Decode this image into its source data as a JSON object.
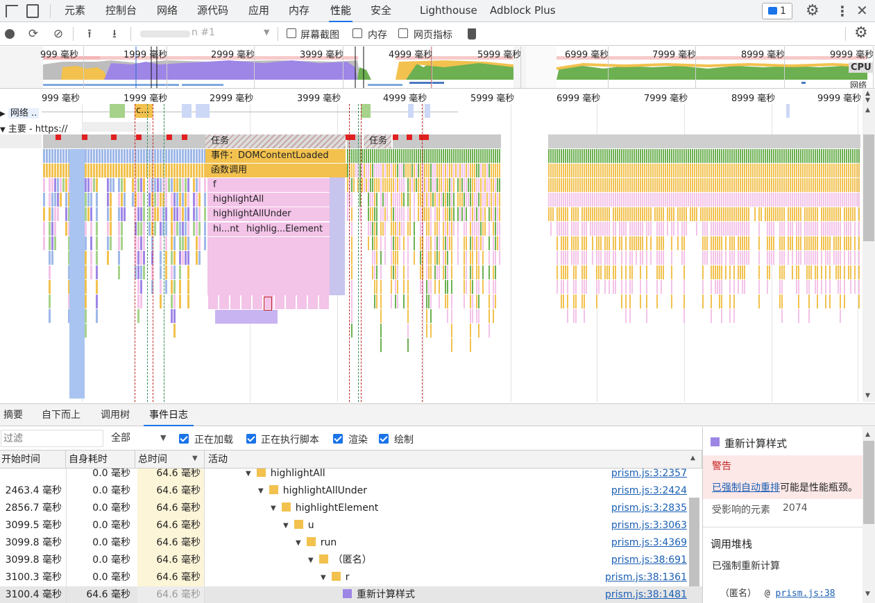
{
  "tabs": [
    "元素",
    "控制台",
    "网络",
    "源代码",
    "应用",
    "内存",
    "性能",
    "安全",
    "Lighthouse",
    "Adblock Plus"
  ],
  "active_tab": "性能",
  "issues_count": "1",
  "toolbar": {
    "recording_label": "n #1",
    "screenshots_label": "屏幕截图",
    "memory_label": "内存",
    "web_vitals_label": "网页指标"
  },
  "overview": {
    "ticks": [
      "999 毫秒",
      "1999 毫秒",
      "2999 毫秒",
      "3999 毫秒",
      "4999 毫秒",
      "5999 毫秒",
      "6999 毫秒",
      "7999 毫秒",
      "8999 毫秒",
      "9999 毫秒"
    ],
    "cpu_label": "CPU",
    "net_label": "网络"
  },
  "timeline": {
    "ticks": [
      "999 毫秒",
      "1999 毫秒",
      "2999 毫秒",
      "3999 毫秒",
      "4999 毫秒",
      "5999 毫秒",
      "6999 毫秒",
      "7999 毫秒",
      "8999 毫秒",
      "9999 毫秒"
    ],
    "network_track": "网络 ..",
    "network_item": "c...",
    "main_track": "主要 - https://"
  },
  "flame": {
    "task1": "任务",
    "task2": "任务",
    "event": "事件：DOMContentLoaded",
    "funccall": "函数调用",
    "f": "f",
    "highlightAll": "highlightAll",
    "highlightAllUnder": "highlightAllUnder",
    "hint": "hi...nt",
    "highlightElement": "highlig...Element"
  },
  "bottom_tabs": [
    "摘要",
    "自下而上",
    "调用树",
    "事件日志"
  ],
  "active_bottom_tab": "事件日志",
  "filter": {
    "placeholder": "过滤",
    "scope": "全部",
    "loading": "正在加载",
    "scripting": "正在执行脚本",
    "rendering": "渲染",
    "painting": "绘制"
  },
  "columns": [
    "开始时间",
    "自身耗时",
    "总时间",
    "活动"
  ],
  "rows": [
    {
      "start": "",
      "self": "0.0 毫秒",
      "total": "64.6 毫秒",
      "indent": 3,
      "name": "highlightAll",
      "color": "#f2c14e",
      "link": "prism.js:3:2357"
    },
    {
      "start": "2463.4 毫秒",
      "self": "0.0 毫秒",
      "total": "64.6 毫秒",
      "indent": 4,
      "name": "highlightAllUnder",
      "color": "#f2c14e",
      "link": "prism.js:3:2424"
    },
    {
      "start": "2856.7 毫秒",
      "self": "0.0 毫秒",
      "total": "64.6 毫秒",
      "indent": 5,
      "name": "highlightElement",
      "color": "#f2c14e",
      "link": "prism.js:3:2835"
    },
    {
      "start": "3099.5 毫秒",
      "self": "0.0 毫秒",
      "total": "64.6 毫秒",
      "indent": 6,
      "name": "u",
      "color": "#f2c14e",
      "link": "prism.js:3:3063"
    },
    {
      "start": "3099.8 毫秒",
      "self": "0.0 毫秒",
      "total": "64.6 毫秒",
      "indent": 7,
      "name": "run",
      "color": "#f2c14e",
      "link": "prism.js:3:4369"
    },
    {
      "start": "3099.8 毫秒",
      "self": "0.0 毫秒",
      "total": "64.6 毫秒",
      "indent": 8,
      "name": "（匿名）",
      "color": "#f2c14e",
      "link": "prism.js:38:691"
    },
    {
      "start": "3100.3 毫秒",
      "self": "0.0 毫秒",
      "total": "64.6 毫秒",
      "indent": 9,
      "name": "r",
      "color": "#f2c14e",
      "link": "prism.js:38:1361"
    },
    {
      "start": "3100.4 毫秒",
      "self": "64.6 毫秒",
      "total": "64.6 毫秒",
      "indent": 11,
      "name": "重新计算样式",
      "color": "#9e86e6",
      "link": "prism.js:38:1481"
    }
  ],
  "detail": {
    "title": "重新计算样式",
    "warning_label": "警告",
    "warning_link": "已强制自动重排",
    "warning_text": "可能是性能瓶颈。",
    "affected_label": "受影响的元素",
    "affected_count": "2074",
    "stack_label": "调用堆栈",
    "forced_label": "已强制重新计算",
    "anon_label": "（匿名）",
    "anon_at": "@",
    "anon_link": "prism.js:38"
  }
}
